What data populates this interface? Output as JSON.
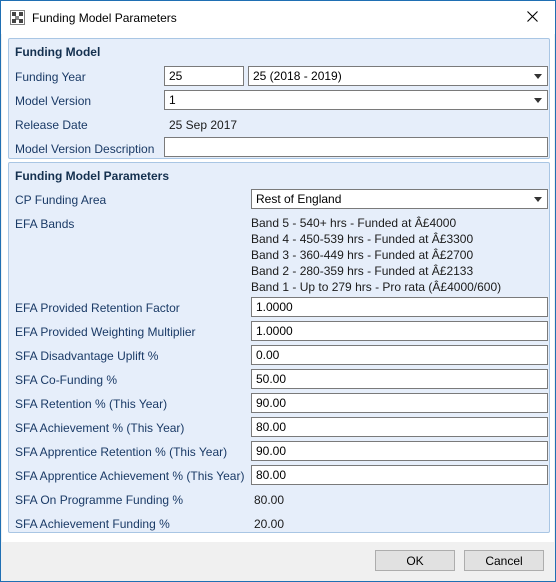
{
  "window": {
    "title": "Funding Model Parameters",
    "icon": "app-icon",
    "close_icon": "close-icon"
  },
  "funding_model": {
    "heading": "Funding Model",
    "funding_year_label": "Funding Year",
    "funding_year_value": "25",
    "funding_year_combo": "25 (2018 - 2019)",
    "model_version_label": "Model Version",
    "model_version_value": "1",
    "release_date_label": "Release Date",
    "release_date_value": "25 Sep 2017",
    "description_label": "Model Version Description",
    "description_value": ""
  },
  "parameters": {
    "heading": "Funding Model Parameters",
    "cp_area_label": "CP Funding Area",
    "cp_area_value": "Rest of England",
    "efa_bands_label": "EFA Bands",
    "efa_bands": [
      "Band 5 - 540+ hrs - Funded at Â£4000",
      "Band 4 - 450-539 hrs - Funded at Â£3300",
      "Band 3 - 360-449 hrs - Funded at Â£2700",
      "Band 2 - 280-359 hrs - Funded at Â£2133",
      "Band 1 - Up to 279 hrs - Pro rata (Â£4000/600)"
    ],
    "fields": [
      {
        "label": "EFA Provided Retention Factor",
        "value": "1.0000",
        "editable": true
      },
      {
        "label": "EFA Provided Weighting Multiplier",
        "value": "1.0000",
        "editable": true
      },
      {
        "label": "SFA Disadvantage Uplift %",
        "value": "0.00",
        "editable": true
      },
      {
        "label": "SFA Co-Funding %",
        "value": "50.00",
        "editable": true
      },
      {
        "label": "SFA Retention % (This Year)",
        "value": "90.00",
        "editable": true
      },
      {
        "label": "SFA Achievement % (This Year)",
        "value": "80.00",
        "editable": true
      },
      {
        "label": "SFA Apprentice Retention % (This Year)",
        "value": "90.00",
        "editable": true
      },
      {
        "label": "SFA Apprentice Achievement % (This Year)",
        "value": "80.00",
        "editable": true
      },
      {
        "label": "SFA On Programme Funding %",
        "value": "80.00",
        "editable": false
      },
      {
        "label": "SFA Achievement Funding %",
        "value": "20.00",
        "editable": false
      }
    ]
  },
  "buttons": {
    "ok": "OK",
    "cancel": "Cancel"
  }
}
